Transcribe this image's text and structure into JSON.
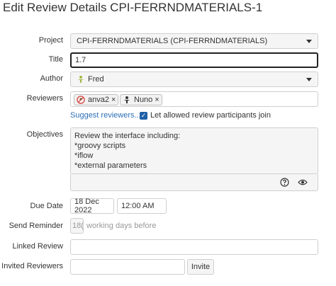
{
  "dialog": {
    "title": "Edit Review Details CPI-FERRNDMATERIALS-1"
  },
  "fields": {
    "project": {
      "label": "Project",
      "value": "CPI-FERRNDMATERIALS (CPI-FERRNDMATERIALS)"
    },
    "title": {
      "label": "Title",
      "value": "1.7"
    },
    "author": {
      "label": "Author",
      "value": "Fred",
      "avatar_icon": "person-icon"
    },
    "reviewers": {
      "label": "Reviewers",
      "items": [
        {
          "name": "anva2",
          "remove": "×",
          "avatar_icon": "blocked-avatar-icon"
        },
        {
          "name": "Nuno",
          "remove": "×",
          "avatar_icon": "person-icon"
        }
      ]
    },
    "suggest_link": "Suggest reviewers...",
    "allowed_checkbox": {
      "label": "Let allowed review participants join",
      "checked": true
    },
    "objectives": {
      "label": "Objectives",
      "lines": [
        "Review the interface including:",
        "*groovy scripts",
        "*iflow",
        "*external parameters"
      ]
    },
    "due_date": {
      "label": "Due Date",
      "date": "18 Dec 2022",
      "time": "12:00 AM"
    },
    "send_reminder": {
      "label": "Send Reminder",
      "value": "18(",
      "suffix": "working days before"
    },
    "linked_review": {
      "label": "Linked Review",
      "value": ""
    },
    "invited_reviewers": {
      "label": "Invited Reviewers",
      "value": "",
      "button": "Invite"
    }
  },
  "colors": {
    "link": "#2d6fb7",
    "checkbox": "#1f5fa8"
  }
}
